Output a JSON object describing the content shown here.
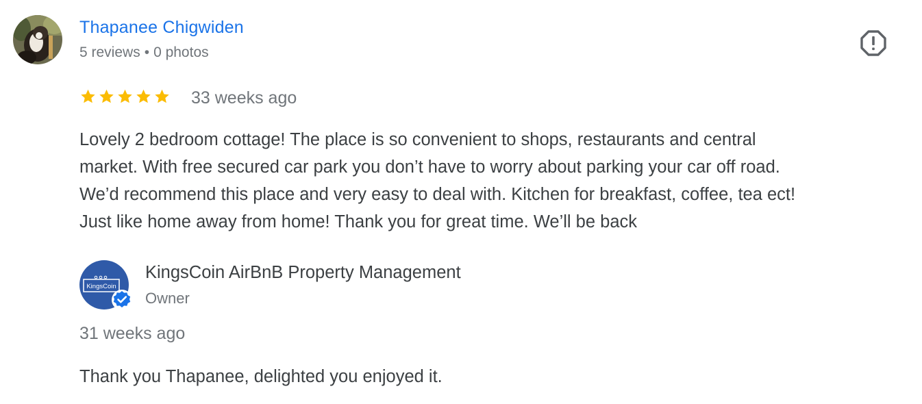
{
  "review": {
    "reviewer_name": "Thapanee Chigwiden",
    "reviews_count": "5 reviews",
    "separator": "•",
    "photos_count": "0 photos",
    "rating": 5,
    "rating_max": 5,
    "date": "33 weeks ago",
    "text_lines": [
      "Lovely 2 bedroom cottage! The place is so convenient to shops, restaurants and central",
      "market. With free secured car park you don’t have to worry about parking your car off road.",
      "We’d recommend this place and very easy to deal with. Kitchen for breakfast, coffee, tea ect!",
      "Just like home away from home! Thank you for great time. We’ll be back"
    ],
    "icons": {
      "avatar": "profile-photo-icon",
      "flag": "report-flag-icon",
      "star": "star-icon"
    }
  },
  "owner_response": {
    "name": "KingsCoin AirBnB Property Management",
    "role": "Owner",
    "logo_text": "KingsCoin",
    "date": "31 weeks ago",
    "text": "Thank you Thapanee, delighted you enjoyed it.",
    "icons": {
      "avatar": "owner-logo-icon",
      "verified": "verified-check-icon"
    }
  },
  "colors": {
    "link": "#1a73e8",
    "text": "#3c4043",
    "secondary_text": "#70757a",
    "star": "#fbbc04",
    "owner_logo_bg": "#2f5aa8",
    "verified": "#1a73e8",
    "flag": "#5f6368"
  }
}
